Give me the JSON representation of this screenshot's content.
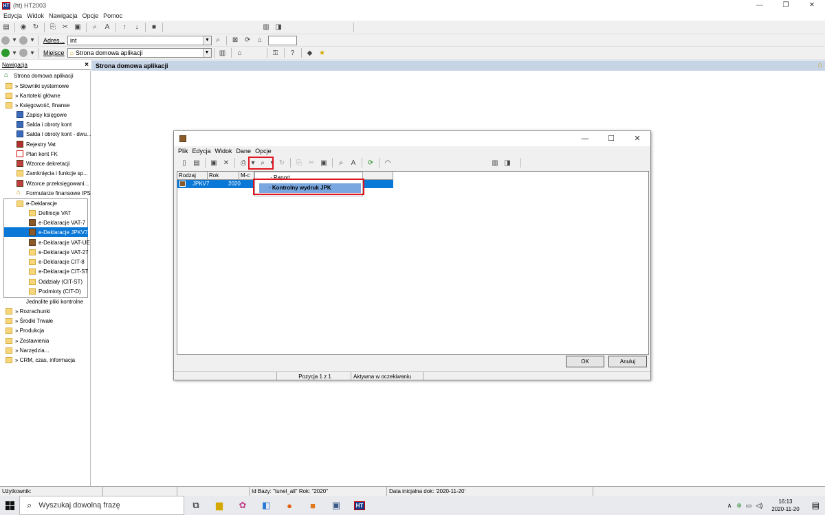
{
  "window": {
    "title": "(ht)  HT2003",
    "app_icon": "HT"
  },
  "menubar": [
    "Edycja",
    "Widok",
    "Nawigacja",
    "Opcje",
    "Pomoc"
  ],
  "address_bar": {
    "label": "Adres...",
    "value": "int"
  },
  "place_bar": {
    "label": "Miejsce",
    "value": "Strona domowa aplikacji"
  },
  "nav": {
    "header": "Nawigacja",
    "items": [
      {
        "label": "Strona domowa aplikacji",
        "icon": "home-icon"
      },
      {
        "label": "» Słowniki systemowe",
        "icon": "folder-icon"
      },
      {
        "label": "» Kartoteki główne",
        "icon": "folder-icon"
      },
      {
        "label": "» Księgowość, finanse",
        "icon": "folder-icon"
      },
      {
        "label": "Zapisy księgowe",
        "icon": "document-icon"
      },
      {
        "label": "Salda i obroty kont",
        "icon": "document-icon"
      },
      {
        "label": "Salda i obroty kont - dwu...",
        "icon": "document-icon"
      },
      {
        "label": "Rejestry Vat",
        "icon": "book-icon"
      },
      {
        "label": "Plan kont FK",
        "icon": "document-icon"
      },
      {
        "label": "Wzorce dekretacji",
        "icon": "grid-icon"
      },
      {
        "label": "Zamknięcia i funkcje sp...",
        "icon": "folder-icon"
      },
      {
        "label": "Wzorce przeksięgowani...",
        "icon": "grid-icon"
      },
      {
        "label": "Formularze finansowe IPS",
        "icon": "form-icon"
      },
      {
        "label": "e-Deklaracje",
        "icon": "folder-icon"
      },
      {
        "label": "Definicje VAT",
        "icon": "folder-icon"
      },
      {
        "label": "e-Deklaracje VAT-7",
        "icon": "grid-icon"
      },
      {
        "label": "e-Deklaracje JPKV7",
        "icon": "grid-icon"
      },
      {
        "label": "e-Deklaracje VAT-UE",
        "icon": "grid-icon"
      },
      {
        "label": "e-Deklaracje VAT-27",
        "icon": "folder-icon"
      },
      {
        "label": "e-Deklaracje CIT-8",
        "icon": "folder-icon"
      },
      {
        "label": "e-Deklaracje CIT-ST",
        "icon": "folder-icon"
      },
      {
        "label": "Oddziały (CIT-ST)",
        "icon": "folder-icon"
      },
      {
        "label": "Podmioty (CIT-D)",
        "icon": "folder-icon"
      },
      {
        "label": "Jednolite pliki kontrolne",
        "icon": "none"
      },
      {
        "label": "» Rozrachunki",
        "icon": "folder-icon"
      },
      {
        "label": "» Środki Trwałe",
        "icon": "folder-icon"
      },
      {
        "label": "» Produkcja",
        "icon": "folder-icon"
      },
      {
        "label": "» Zestawienia",
        "icon": "folder-icon"
      },
      {
        "label": "» Narzędzia...",
        "icon": "folder-icon"
      },
      {
        "label": "» CRM, czas, informacja",
        "icon": "folder-icon"
      }
    ]
  },
  "main": {
    "header": "Strona domowa aplikacji"
  },
  "dialog": {
    "menu": [
      "Plik",
      "Edycja",
      "Widok",
      "Dane",
      "Opcje"
    ],
    "columns": [
      "Rodzaj",
      "Rok",
      "M-c"
    ],
    "row": {
      "rodzaj": "JPKV7",
      "rok": "2020"
    },
    "dropdown": [
      "Raport",
      "Kontrolny wydruk JPK"
    ],
    "ok_label": "OK",
    "cancel_label": "Anuluj",
    "status": [
      "Pozycja 1 z 1",
      "Aktywna w oczekiwaniu"
    ]
  },
  "statusbar": {
    "user": "Użytkownik:",
    "db": "Id Bazy: \"tunel_all\" Rok: \"2020\"",
    "date": "Data inicjalna dok: '2020-11-20'"
  },
  "taskbar": {
    "search_placeholder": "Wyszukaj dowolną frazę",
    "time": "16:13",
    "date": "2020-11-20"
  }
}
